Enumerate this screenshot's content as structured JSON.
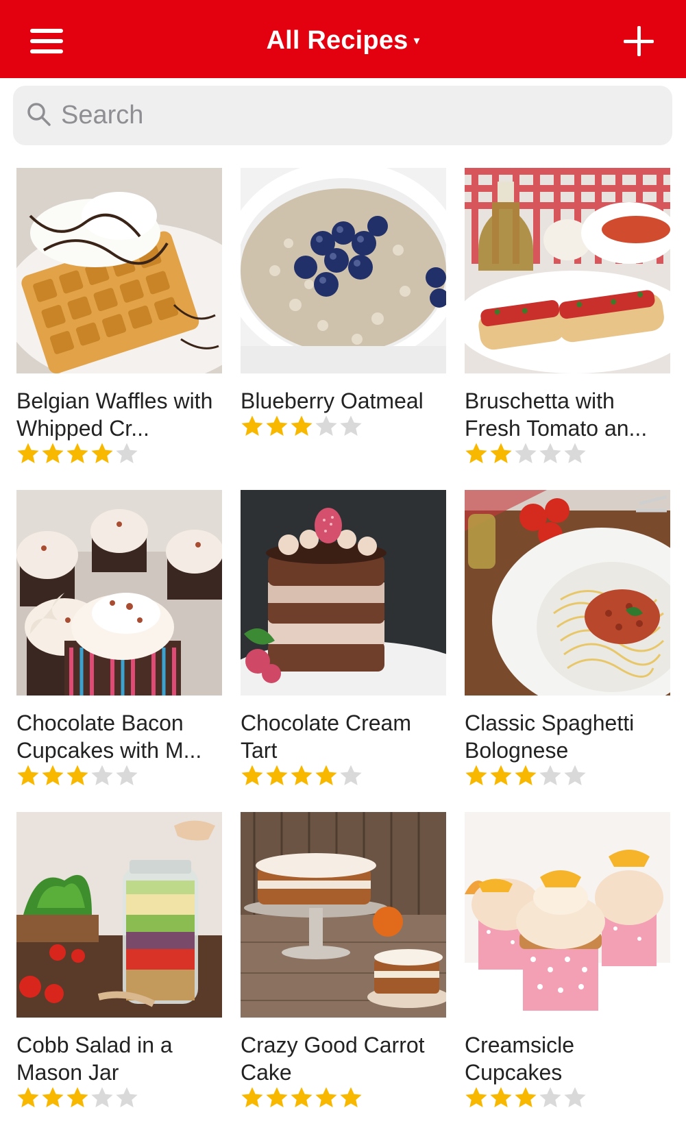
{
  "header": {
    "title": "All Recipes",
    "caret": "▾",
    "menu_icon": "hamburger-menu-icon",
    "add_icon": "plus-icon",
    "bar_color": "#e3000f"
  },
  "search": {
    "placeholder": "Search",
    "icon": "search-icon"
  },
  "colors": {
    "star_filled": "#f9b800",
    "star_empty": "#d9d9d9"
  },
  "recipes": [
    {
      "name": "Belgian Waffles with Whipped Cr...",
      "rating": 4
    },
    {
      "name": "Blueberry Oatmeal",
      "rating": 3
    },
    {
      "name": "Bruschetta with Fresh Tomato an...",
      "rating": 2
    },
    {
      "name": "Chocolate Bacon Cupcakes with M...",
      "rating": 3
    },
    {
      "name": "Chocolate Cream Tart",
      "rating": 4
    },
    {
      "name": "Classic Spaghetti Bolognese",
      "rating": 3
    },
    {
      "name": "Cobb Salad in a Mason Jar",
      "rating": 3
    },
    {
      "name": "Crazy Good Carrot Cake",
      "rating": 5
    },
    {
      "name": "Creamsicle Cupcakes",
      "rating": 3
    }
  ]
}
